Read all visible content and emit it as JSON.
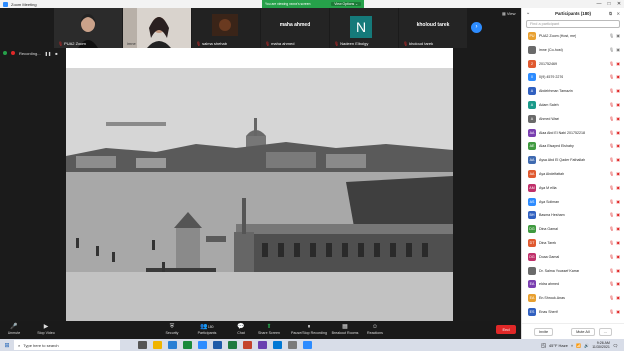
{
  "window": {
    "title": "Zoom Meeting",
    "controls": [
      "—",
      "□",
      "✕"
    ]
  },
  "share_banner": {
    "message": "You are viewing xxxxx's screen",
    "options_label": "View Options ⌄"
  },
  "view_label": "▦ View",
  "video_tiles": [
    {
      "name": "PUA2 Zoom"
    },
    {
      "name": "imne"
    },
    {
      "name": "salma shehab"
    },
    {
      "name": "maha ahmed",
      "display": "maha ahmed"
    },
    {
      "name": "Nadeen Elbolgy",
      "initial": "N"
    },
    {
      "name": "kholoud tarek",
      "display": "kholoud tarek"
    }
  ],
  "recording": {
    "label": "Recording..."
  },
  "toolbar": {
    "buttons": [
      {
        "label": "Unmute",
        "icon": "mic-muted-icon"
      },
      {
        "label": "Stop Video",
        "icon": "video-icon"
      },
      {
        "label": "Security",
        "icon": "shield-icon"
      },
      {
        "label": "Participants",
        "count": "180",
        "icon": "people-icon"
      },
      {
        "label": "Chat",
        "icon": "chat-icon"
      },
      {
        "label": "Share Screen",
        "icon": "share-screen-icon"
      },
      {
        "label": "Pause/Stop Recording",
        "icon": "pause-recording-icon"
      },
      {
        "label": "Breakout Rooms",
        "icon": "breakout-icon"
      },
      {
        "label": "Reactions",
        "icon": "reaction-icon"
      }
    ],
    "end_label": "End"
  },
  "participants": {
    "title": "Participants (180)",
    "search_placeholder": "Find a participant",
    "list": [
      {
        "name": "PUA2 Zoom (Host, me)",
        "initials": "PU",
        "color": "#e8a030",
        "mic": "on",
        "cam": "on"
      },
      {
        "name": "imne (Co-host)",
        "initials": "",
        "color": "#6a6a6a",
        "mic": "on",
        "cam": "on"
      },
      {
        "name": "201752469",
        "initials": "2",
        "color": "#e05a30",
        "mic": "off",
        "cam": "off"
      },
      {
        "name": "0(9) 4579 2276",
        "initials": "0",
        "color": "#2d8cff",
        "mic": "off",
        "cam": "off"
      },
      {
        "name": "Abdelrhman Tamazin",
        "initials": "A",
        "color": "#3060c0",
        "mic": "off",
        "cam": "off"
      },
      {
        "name": "Adam Saleh",
        "initials": "A",
        "color": "#1a9a8a",
        "mic": "off",
        "cam": "off"
      },
      {
        "name": "Ahmed Wael",
        "initials": "A",
        "color": "#6a6a6a",
        "mic": "off",
        "cam": "off"
      },
      {
        "name": "Alaa Abd El Nabi 201752218",
        "initials": "AA",
        "color": "#7a3fb0",
        "mic": "off",
        "cam": "off"
      },
      {
        "name": "Alaa Elsayed Elshaby",
        "initials": "AE",
        "color": "#3f9a3f",
        "mic": "off",
        "cam": "off"
      },
      {
        "name": "Aysa Abd El Qader Fathallah",
        "initials": "AA",
        "color": "#3f6ab0",
        "mic": "off",
        "cam": "off"
      },
      {
        "name": "Aya Abdelfattah",
        "initials": "AA",
        "color": "#e05a30",
        "mic": "off",
        "cam": "off"
      },
      {
        "name": "Aya M ellia",
        "initials": "AM",
        "color": "#c0306a",
        "mic": "off",
        "cam": "off"
      },
      {
        "name": "Aya Soliman",
        "initials": "AS",
        "color": "#2d8cff",
        "mic": "off",
        "cam": "off"
      },
      {
        "name": "Basma Hesham",
        "initials": "BH",
        "color": "#3060c0",
        "mic": "off",
        "cam": "off"
      },
      {
        "name": "Dina Gamal",
        "initials": "DG",
        "color": "#3f9a3f",
        "mic": "off",
        "cam": "off"
      },
      {
        "name": "Dina Tarek",
        "initials": "DT",
        "color": "#e05a30",
        "mic": "off",
        "cam": "off"
      },
      {
        "name": "Doaa Gamal",
        "initials": "DG",
        "color": "#c0306a",
        "mic": "off",
        "cam": "off"
      },
      {
        "name": "Dr. Salma Youssef Karrar",
        "initials": "",
        "color": "#6a6a6a",
        "mic": "off",
        "cam": "off"
      },
      {
        "name": "eldra ahmed",
        "initials": "EA",
        "color": "#7a3fb0",
        "mic": "off",
        "cam": "off"
      },
      {
        "name": "En.Shrouk.Anas",
        "initials": "EA",
        "color": "#e8a030",
        "mic": "off",
        "cam": "off"
      },
      {
        "name": "Enas Sherif",
        "initials": "ES",
        "color": "#3060c0",
        "mic": "off",
        "cam": "off"
      }
    ],
    "invite_label": "Invite",
    "mute_all_label": "Mute All",
    "more_label": "..."
  },
  "taskbar": {
    "search_placeholder": "Type here to search",
    "weather": "45°F Haze",
    "time": "9:26 AM",
    "date": "11/30/2021"
  }
}
